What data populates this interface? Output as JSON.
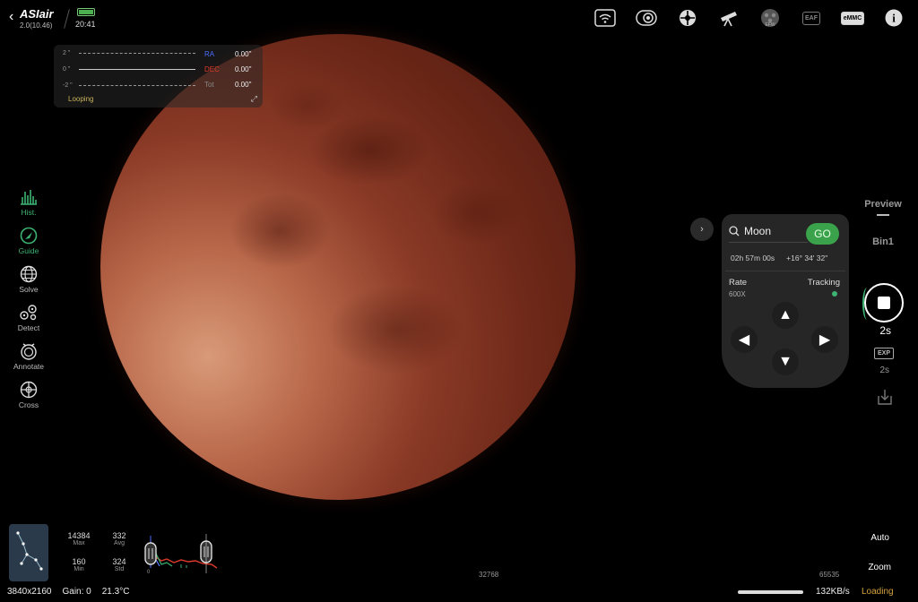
{
  "header": {
    "brand": "ASIair",
    "version": "2.0(10.46)",
    "time": "20:41",
    "battery_level": 1.0,
    "icons": [
      "wifi-icon",
      "camera-icon",
      "target-icon",
      "telescope-icon",
      "efw-icon",
      "eaf-icon",
      "emmc-icon",
      "info-icon"
    ],
    "efw_label": "EFW",
    "eaf_label": "EAF",
    "emmc_label": "eMMC",
    "info_label": "i"
  },
  "guide_graph": {
    "y_labels": [
      "2 \"",
      "0 \"",
      "-2 \""
    ],
    "ra_label": "RA",
    "dec_label": "DEC",
    "tot_label": "Tot",
    "ra_value": "0.00\"",
    "dec_value": "0.00\"",
    "tot_value": "0.00\"",
    "status": "Looping",
    "colors": {
      "ra": "#4a6cff",
      "dec": "#e03a2a"
    }
  },
  "left_tools": [
    {
      "label": "Hist.",
      "icon": "histogram-icon"
    },
    {
      "label": "Guide",
      "icon": "guide-icon"
    },
    {
      "label": "Solve",
      "icon": "globe-icon"
    },
    {
      "label": "Detect",
      "icon": "detect-icon"
    },
    {
      "label": "Annotate",
      "icon": "annotate-icon"
    },
    {
      "label": "Cross",
      "icon": "crosshair-icon"
    }
  ],
  "goto_panel": {
    "target": "Moon",
    "go_label": "GO",
    "ra": "02h 57m 00s",
    "dec": "+16° 34' 32\"",
    "rate_label": "Rate",
    "rate_value": "600X",
    "tracking_label": "Tracking",
    "tracking_on": true
  },
  "right_panel": {
    "preview_label": "Preview",
    "bin_label": "Bin1",
    "exposure": "2s",
    "exp_badge": "EXP",
    "exp_sub": "2s"
  },
  "stats": {
    "max": "14384",
    "max_label": "Max",
    "avg": "332",
    "avg_label": "Avg",
    "min": "160",
    "min_label": "Min",
    "std": "324",
    "std_label": "Std",
    "hist_zero": "0",
    "hist_mid": "32768",
    "hist_max": "65535"
  },
  "bottom": {
    "resolution": "3840x2160",
    "gain": "Gain: 0",
    "temperature": "21.3°C",
    "auto_label": "Auto",
    "zoom_label": "Zoom",
    "speed": "132KB/s",
    "loading": "Loading"
  }
}
